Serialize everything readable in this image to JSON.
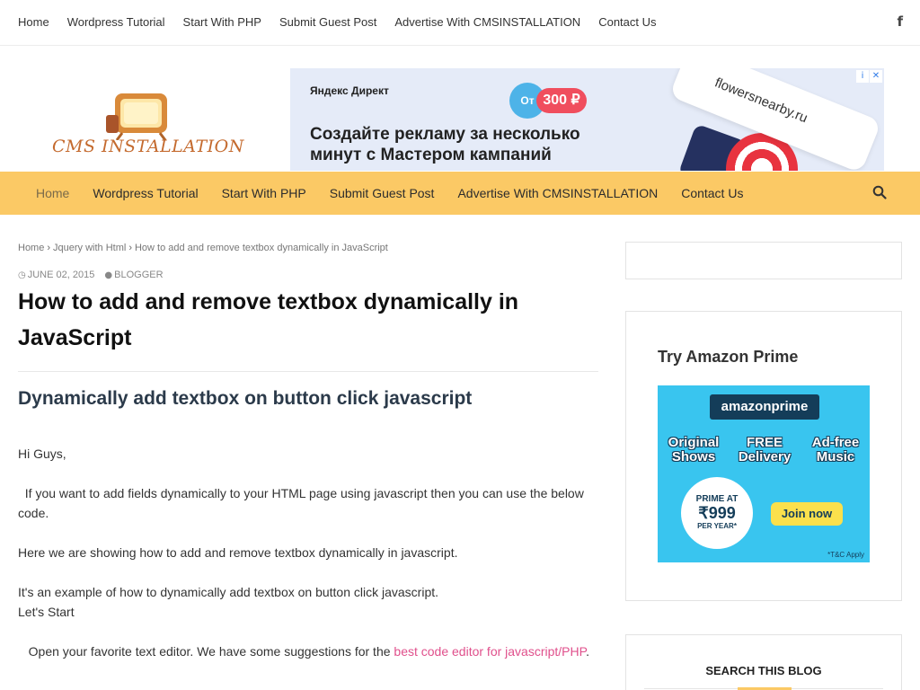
{
  "top_nav": {
    "items": [
      "Home",
      "Wordpress Tutorial",
      "Start With PHP",
      "Submit Guest Post",
      "Advertise With CMSINSTALLATION",
      "Contact Us"
    ],
    "social_icon": "f"
  },
  "logo": {
    "text": "CMS INSTALLATION"
  },
  "ad": {
    "brand": "Яндекс Директ",
    "price_prefix": "От",
    "price": "300 ₽",
    "headline": "Создайте рекламу за несколько минут с Мастером кампаний",
    "card_text": "flowersnearby.ru",
    "info_icon": "i",
    "close_icon": "✕"
  },
  "main_nav": {
    "items": [
      "Home",
      "Wordpress Tutorial",
      "Start With PHP",
      "Submit Guest Post",
      "Advertise With CMSINSTALLATION",
      "Contact Us"
    ],
    "active": "Home"
  },
  "breadcrumb": {
    "home": "Home",
    "category": "Jquery with Html",
    "current": "How to add and remove textbox dynamically in JavaScript"
  },
  "post": {
    "date": "JUNE 02, 2015",
    "author": "BLOGGER",
    "title": "How to add and remove textbox dynamically in JavaScript",
    "heading": "Dynamically add textbox on button click javascript",
    "p1": "Hi Guys,",
    "p2": "  If you want to add fields dynamically to your HTML page using javascript then you can use the below code.",
    "p3": "Here we are showing how to add and remove textbox dynamically in javascript.",
    "p4": "It's an example of how to dynamically add textbox on button click javascript.",
    "p5": "Let's Start",
    "p6_text": "   Open your favorite text editor. We have some suggestions for the ",
    "p6_link": "best code editor for javascript/PHP",
    "p6_end": "."
  },
  "sidebar": {
    "widget_title": "Try Amazon Prime",
    "prime": {
      "logo": "amazonprime",
      "features": [
        "Original Shows",
        "FREE Delivery",
        "Ad-free Music"
      ],
      "badge_line1": "PRIME AT",
      "badge_line2": "₹999",
      "badge_line3": "PER YEAR*",
      "join": "Join now",
      "tc": "*T&C Apply"
    },
    "search_title": "SEARCH THIS BLOG"
  }
}
